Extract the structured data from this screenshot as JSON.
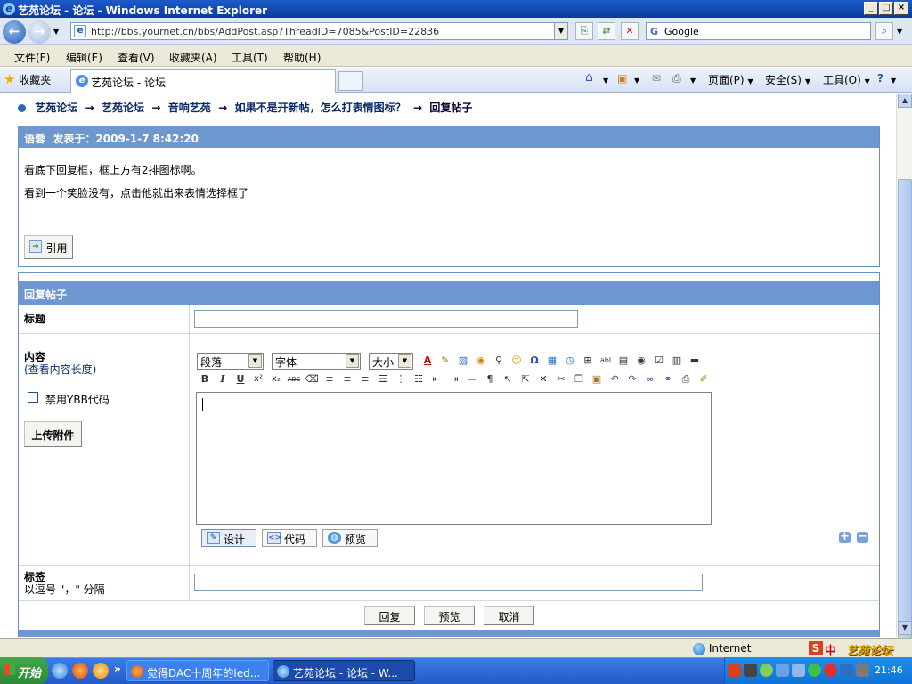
{
  "window": {
    "title": "艺苑论坛 - 论坛 - Windows Internet Explorer",
    "minimize": "_",
    "maximize": "□",
    "close": "×"
  },
  "address": {
    "url": "http://bbs.yournet.cn/bbs/AddPost.asp?ThreadID=7085&PostID=22836",
    "search_value": "Google"
  },
  "menu": [
    "文件(F)",
    "编辑(E)",
    "查看(V)",
    "收藏夹(A)",
    "工具(T)",
    "帮助(H)"
  ],
  "toolbar": {
    "favorites": "收藏夹",
    "tab_title": "艺苑论坛 - 论坛",
    "page": "页面(P)",
    "safety": "安全(S)",
    "tools": "工具(O)"
  },
  "breadcrumb": {
    "items": [
      "艺苑论坛",
      "艺苑论坛",
      "音响艺苑",
      "如果不是开新帖，怎么打表情图标？",
      "回复帖子"
    ],
    "separator": "→"
  },
  "post": {
    "author": "语蓉",
    "posted_label": "发表于：",
    "posted_at": "2009-1-7 8:42:20",
    "line1": "看底下回复框，框上方有2排图标啊。",
    "line2": "看到一个笑脸没有，点击他就出来表情选择框了",
    "quote_button": "引用"
  },
  "reply": {
    "header": "回复帖子",
    "title_label": "标题",
    "title_value": "",
    "content_label": "内容",
    "content_length_link": "(查看内容长度)",
    "disable_ybb_label": "禁用YBB代码",
    "upload_button": "上传附件",
    "format_select": "段落",
    "font_select": "字体",
    "size_select": "大小",
    "mode_design": "设计",
    "mode_code": "代码",
    "mode_preview": "预览",
    "tags_label": "标签",
    "tags_hint": "以逗号 \"，\" 分隔",
    "tags_value": "",
    "submit_button": "回复",
    "preview_button": "预览",
    "cancel_button": "取消"
  },
  "status": {
    "zone": "Internet"
  },
  "taskbar": {
    "start": "开始",
    "task1": "觉得DAC十周年的led...",
    "task2": "艺苑论坛 - 论坛 - W...",
    "ime": "中",
    "clock": "21:46",
    "watermark": "艺苑论坛"
  },
  "colors": {
    "header_blue": "#6f97cf",
    "border_blue": "#6a8fc4",
    "taskbar_blue": "#2458c9"
  }
}
